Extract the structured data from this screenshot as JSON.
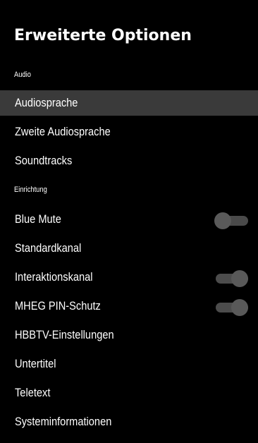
{
  "title": "Erweiterte Optionen",
  "sections": {
    "audio": "Audio",
    "setup": "Einrichtung"
  },
  "items": {
    "audiosprache": {
      "label": "Audiosprache",
      "selected": true
    },
    "zweite_audiosprache": {
      "label": "Zweite Audiosprache"
    },
    "soundtracks": {
      "label": "Soundtracks"
    },
    "blue_mute": {
      "label": "Blue Mute",
      "toggle": "off"
    },
    "standardkanal": {
      "label": "Standardkanal"
    },
    "interaktionskanal": {
      "label": "Interaktionskanal",
      "toggle": "on"
    },
    "mheg_pin_schutz": {
      "label": "MHEG PIN-Schutz",
      "toggle": "on"
    },
    "hbbtv_einstellungen": {
      "label": "HBBTV-Einstellungen"
    },
    "untertitel": {
      "label": "Untertitel"
    },
    "teletext": {
      "label": "Teletext"
    },
    "systeminformationen": {
      "label": "Systeminformationen"
    }
  },
  "colors": {
    "background": "#000000",
    "text": "#ffffff",
    "selected_row": "#3a3a3a",
    "toggle": "#4a4a4a"
  }
}
